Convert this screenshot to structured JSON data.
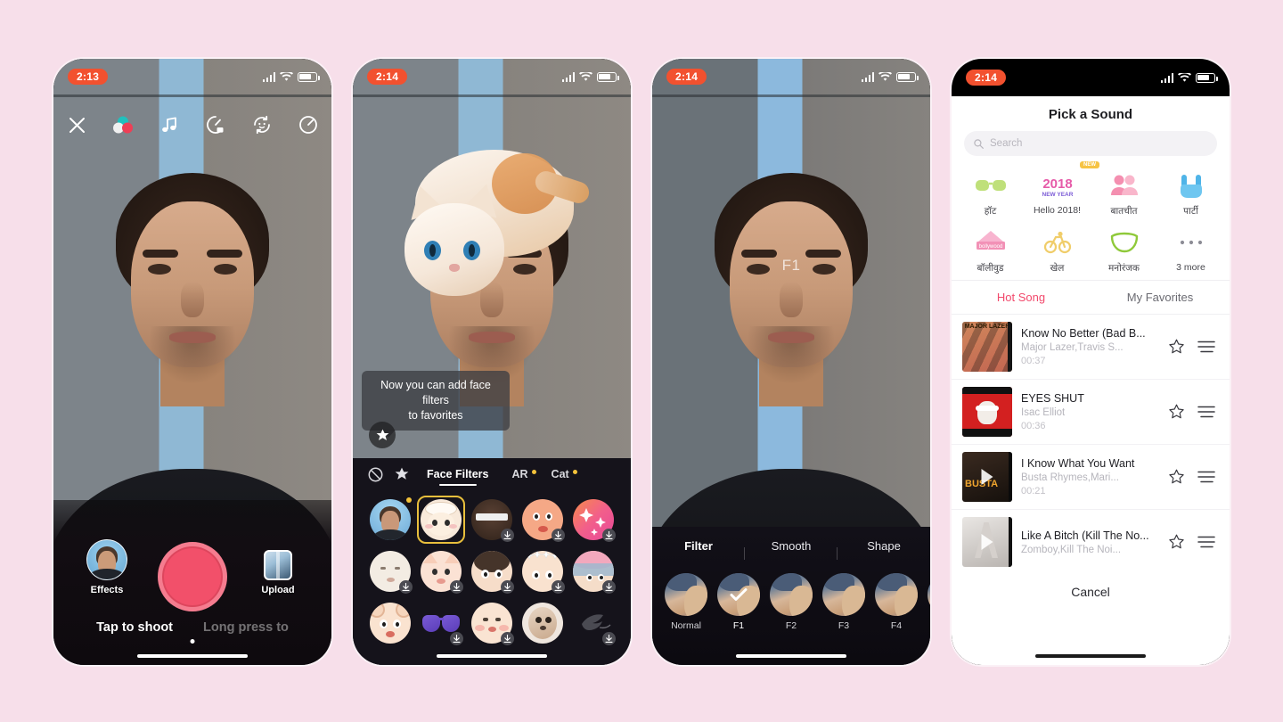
{
  "background_color": "#f7dfea",
  "phones": {
    "phone1": {
      "status": {
        "time": "2:13"
      },
      "toolbar": [
        {
          "name": "close",
          "icon": "close-icon"
        },
        {
          "name": "filters",
          "icon": "color-bubbles-icon"
        },
        {
          "name": "music",
          "icon": "music-note-icon"
        },
        {
          "name": "speed",
          "icon": "speed-gauge-icon"
        },
        {
          "name": "flip",
          "icon": "flip-camera-icon"
        },
        {
          "name": "timer",
          "icon": "timer-icon"
        }
      ],
      "effects_label": "Effects",
      "upload_label": "Upload",
      "hint_primary": "Tap to shoot",
      "hint_secondary": "Long press to"
    },
    "phone2": {
      "status": {
        "time": "2:14"
      },
      "tooltip": "Now you can add face filters to favorites",
      "tooltip_line1": "Now you can add face filters",
      "tooltip_line2": "to favorites",
      "tabs": [
        {
          "label": "Face Filters",
          "active": true,
          "badge": false
        },
        {
          "label": "AR",
          "active": false,
          "badge": true
        },
        {
          "label": "Cat",
          "active": false,
          "badge": true
        }
      ],
      "leading_icons": [
        "no-filter-icon",
        "favorite-star-icon"
      ],
      "stickers": [
        {
          "name": "avatar-selfie",
          "selected": false,
          "download": false,
          "new": true,
          "style": "selfie"
        },
        {
          "name": "cat-ears",
          "selected": true,
          "download": false,
          "new": false,
          "style": "cat"
        },
        {
          "name": "headband",
          "selected": false,
          "download": true,
          "new": false,
          "style": "dark"
        },
        {
          "name": "blush-face",
          "selected": false,
          "download": true,
          "new": false,
          "style": "peach"
        },
        {
          "name": "sparkles",
          "selected": false,
          "download": true,
          "new": false,
          "style": "sparkle"
        },
        {
          "name": "pale-face",
          "selected": false,
          "download": true,
          "new": false,
          "style": "pale"
        },
        {
          "name": "pig-ears",
          "selected": false,
          "download": true,
          "new": false,
          "style": "pig"
        },
        {
          "name": "curly-hair",
          "selected": false,
          "download": true,
          "new": false,
          "style": "curly"
        },
        {
          "name": "star-crown",
          "selected": false,
          "download": true,
          "new": false,
          "style": "stars"
        },
        {
          "name": "grandma",
          "selected": false,
          "download": true,
          "new": false,
          "style": "granny"
        },
        {
          "name": "bear-ears",
          "selected": false,
          "download": false,
          "new": false,
          "style": "bear"
        },
        {
          "name": "sunglasses",
          "selected": false,
          "download": true,
          "new": false,
          "style": "glasses"
        },
        {
          "name": "baby-face",
          "selected": false,
          "download": true,
          "new": false,
          "style": "baby"
        },
        {
          "name": "puppy",
          "selected": false,
          "download": false,
          "new": false,
          "style": "puppy"
        },
        {
          "name": "bird",
          "selected": false,
          "download": true,
          "new": false,
          "style": "bird"
        }
      ]
    },
    "phone3": {
      "status": {
        "time": "2:14"
      },
      "active_filter_overlay": "F1",
      "modes": [
        {
          "label": "Filter",
          "active": true
        },
        {
          "label": "Smooth",
          "active": false
        },
        {
          "label": "Shape",
          "active": false
        }
      ],
      "filters": [
        {
          "label": "Normal",
          "selected": false
        },
        {
          "label": "F1",
          "selected": true
        },
        {
          "label": "F2",
          "selected": false
        },
        {
          "label": "F3",
          "selected": false
        },
        {
          "label": "F4",
          "selected": false
        },
        {
          "label": "",
          "selected": false
        }
      ]
    },
    "phone4": {
      "status": {
        "time": "2:14"
      },
      "title": "Pick a Sound",
      "search_placeholder": "Search",
      "categories": [
        {
          "label": "हॉट",
          "icon": "sunglasses-icon",
          "badge": ""
        },
        {
          "label": "Hello 2018!",
          "icon": "new-year-2018-icon",
          "badge": "NEW"
        },
        {
          "label": "बातचीत",
          "icon": "chat-couple-icon",
          "badge": ""
        },
        {
          "label": "पार्टी",
          "icon": "rock-hand-icon",
          "badge": ""
        },
        {
          "label": "बॉलीवुड",
          "icon": "bollywood-icon",
          "badge": ""
        },
        {
          "label": "खेल",
          "icon": "bicycle-icon",
          "badge": ""
        },
        {
          "label": "मनोरंजक",
          "icon": "smile-mouth-icon",
          "badge": ""
        },
        {
          "label": "3 more",
          "icon": "ellipsis-icon",
          "badge": ""
        }
      ],
      "tabs": [
        {
          "label": "Hot Song",
          "active": true
        },
        {
          "label": "My Favorites",
          "active": false
        }
      ],
      "accent_color": "#f2496c",
      "songs": [
        {
          "title": "Know No Better (Bad B...",
          "artist": "Major Lazer,Travis S...",
          "duration": "00:37",
          "cover": "major-lazer"
        },
        {
          "title": "EYES SHUT",
          "artist": "Isac Elliot",
          "duration": "00:36",
          "cover": "eyes-shut"
        },
        {
          "title": "I Know What You Want",
          "artist": "Busta Rhymes,Mari...",
          "duration": "00:21",
          "cover": "busta"
        },
        {
          "title": "Like A Bitch (Kill The No...",
          "artist": "Zomboy,Kill The Noi...",
          "duration": "",
          "cover": "zomboy"
        }
      ],
      "cancel_label": "Cancel"
    }
  }
}
